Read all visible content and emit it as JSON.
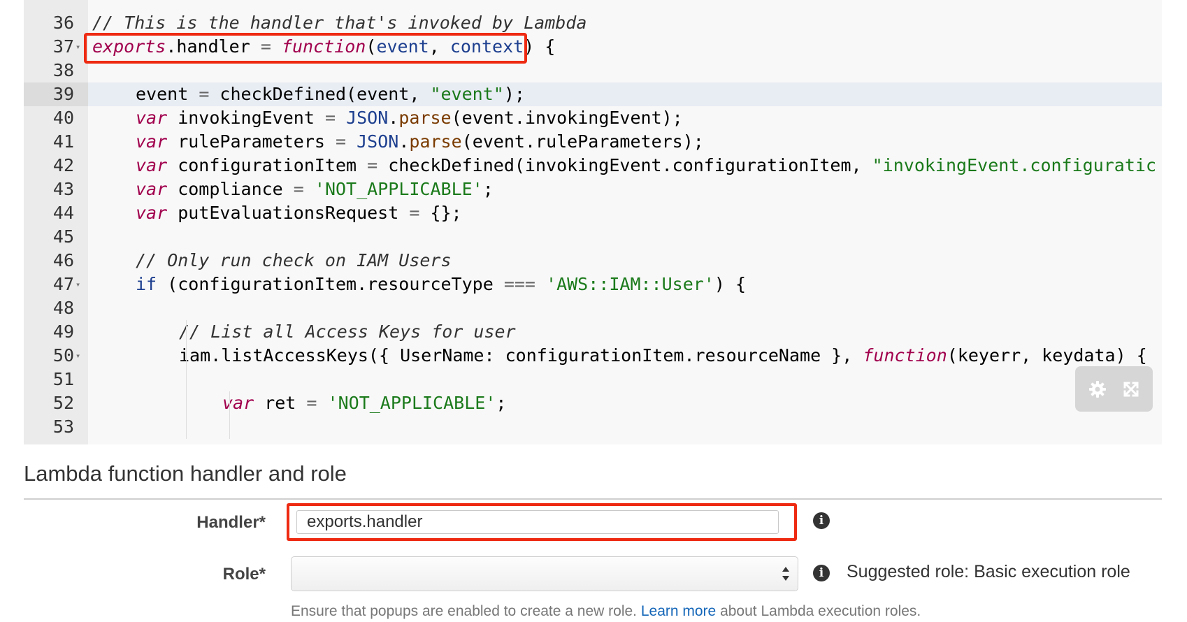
{
  "editor": {
    "lines": [
      {
        "n": "36",
        "fold": "",
        "indent": 0,
        "tokens": [
          {
            "c": "c",
            "t": "// This is the handler that's invoked by Lambda"
          }
        ]
      },
      {
        "n": "37",
        "fold": "▾",
        "indent": 0,
        "tokens": [
          {
            "c": "k",
            "t": "exports"
          },
          {
            "c": "fn",
            "t": ".handler "
          },
          {
            "c": "op",
            "t": "="
          },
          {
            "c": "fn",
            "t": " "
          },
          {
            "c": "k",
            "t": "function"
          },
          {
            "c": "fn",
            "t": "("
          },
          {
            "c": "p",
            "t": "event"
          },
          {
            "c": "fn",
            "t": ", "
          },
          {
            "c": "p",
            "t": "context"
          },
          {
            "c": "fn",
            "t": ") {"
          }
        ]
      },
      {
        "n": "38",
        "fold": "",
        "indent": 0,
        "tokens": []
      },
      {
        "n": "39",
        "fold": "",
        "indent": 1,
        "active": true,
        "tokens": [
          {
            "c": "fn",
            "t": "event "
          },
          {
            "c": "op",
            "t": "="
          },
          {
            "c": "fn",
            "t": " checkDefined(event, "
          },
          {
            "c": "s",
            "t": "\"event\""
          },
          {
            "c": "fn",
            "t": ");"
          }
        ]
      },
      {
        "n": "40",
        "fold": "",
        "indent": 1,
        "tokens": [
          {
            "c": "k",
            "t": "var"
          },
          {
            "c": "fn",
            "t": " invokingEvent "
          },
          {
            "c": "op",
            "t": "="
          },
          {
            "c": "fn",
            "t": " "
          },
          {
            "c": "j",
            "t": "JSON"
          },
          {
            "c": "fn",
            "t": "."
          },
          {
            "c": "k2",
            "t": "parse"
          },
          {
            "c": "fn",
            "t": "(event.invokingEvent);"
          }
        ]
      },
      {
        "n": "41",
        "fold": "",
        "indent": 1,
        "tokens": [
          {
            "c": "k",
            "t": "var"
          },
          {
            "c": "fn",
            "t": " ruleParameters "
          },
          {
            "c": "op",
            "t": "="
          },
          {
            "c": "fn",
            "t": " "
          },
          {
            "c": "j",
            "t": "JSON"
          },
          {
            "c": "fn",
            "t": "."
          },
          {
            "c": "k2",
            "t": "parse"
          },
          {
            "c": "fn",
            "t": "(event.ruleParameters);"
          }
        ]
      },
      {
        "n": "42",
        "fold": "",
        "indent": 1,
        "tokens": [
          {
            "c": "k",
            "t": "var"
          },
          {
            "c": "fn",
            "t": " configurationItem "
          },
          {
            "c": "op",
            "t": "="
          },
          {
            "c": "fn",
            "t": " checkDefined(invokingEvent.configurationItem, "
          },
          {
            "c": "s",
            "t": "\"invokingEvent.configuratic"
          }
        ]
      },
      {
        "n": "43",
        "fold": "",
        "indent": 1,
        "tokens": [
          {
            "c": "k",
            "t": "var"
          },
          {
            "c": "fn",
            "t": " compliance "
          },
          {
            "c": "op",
            "t": "="
          },
          {
            "c": "fn",
            "t": " "
          },
          {
            "c": "s",
            "t": "'NOT_APPLICABLE'"
          },
          {
            "c": "fn",
            "t": ";"
          }
        ]
      },
      {
        "n": "44",
        "fold": "",
        "indent": 1,
        "tokens": [
          {
            "c": "k",
            "t": "var"
          },
          {
            "c": "fn",
            "t": " putEvaluationsRequest "
          },
          {
            "c": "op",
            "t": "="
          },
          {
            "c": "fn",
            "t": " {};"
          }
        ]
      },
      {
        "n": "45",
        "fold": "",
        "indent": 1,
        "tokens": []
      },
      {
        "n": "46",
        "fold": "",
        "indent": 1,
        "tokens": [
          {
            "c": "c",
            "t": "// Only run check on IAM Users"
          }
        ]
      },
      {
        "n": "47",
        "fold": "▾",
        "indent": 1,
        "tokens": [
          {
            "c": "j",
            "t": "if"
          },
          {
            "c": "fn",
            "t": " (configurationItem.resourceType "
          },
          {
            "c": "op",
            "t": "==="
          },
          {
            "c": "fn",
            "t": " "
          },
          {
            "c": "s",
            "t": "'AWS::IAM::User'"
          },
          {
            "c": "fn",
            "t": ") {"
          }
        ]
      },
      {
        "n": "48",
        "fold": "",
        "indent": 1,
        "tokens": []
      },
      {
        "n": "49",
        "fold": "",
        "indent": 2,
        "tokens": [
          {
            "c": "c",
            "t": "// List all Access Keys for user"
          }
        ]
      },
      {
        "n": "50",
        "fold": "▾",
        "indent": 2,
        "tokens": [
          {
            "c": "fn",
            "t": "iam.listAccessKeys({ UserName: configurationItem.resourceName }, "
          },
          {
            "c": "k",
            "t": "function"
          },
          {
            "c": "fn",
            "t": "(keyerr, keydata) {"
          }
        ]
      },
      {
        "n": "51",
        "fold": "",
        "indent": 2,
        "tokens": []
      },
      {
        "n": "52",
        "fold": "",
        "indent": 3,
        "tokens": [
          {
            "c": "k",
            "t": "var"
          },
          {
            "c": "fn",
            "t": " ret "
          },
          {
            "c": "op",
            "t": "="
          },
          {
            "c": "fn",
            "t": " "
          },
          {
            "c": "s",
            "t": "'NOT_APPLICABLE'"
          },
          {
            "c": "fn",
            "t": ";"
          }
        ]
      },
      {
        "n": "53",
        "fold": "",
        "indent": 3,
        "tokens": []
      }
    ],
    "toolbar": {
      "settings_icon": "gear-icon",
      "fullscreen_icon": "expand-icon"
    }
  },
  "section": {
    "title": "Lambda function handler and role"
  },
  "form": {
    "handler_label": "Handler*",
    "handler_value": "exports.handler",
    "role_label": "Role*",
    "role_value": "",
    "suggested_role": "Suggested role: Basic execution role",
    "help_prefix": "Ensure that popups are enabled to create a new role. ",
    "help_link": "Learn more",
    "help_suffix": " about Lambda execution roles."
  },
  "colors": {
    "highlight": "#ee2a12",
    "link": "#1466b8",
    "keyword": "#a1004d",
    "string": "#1b7a1b"
  }
}
